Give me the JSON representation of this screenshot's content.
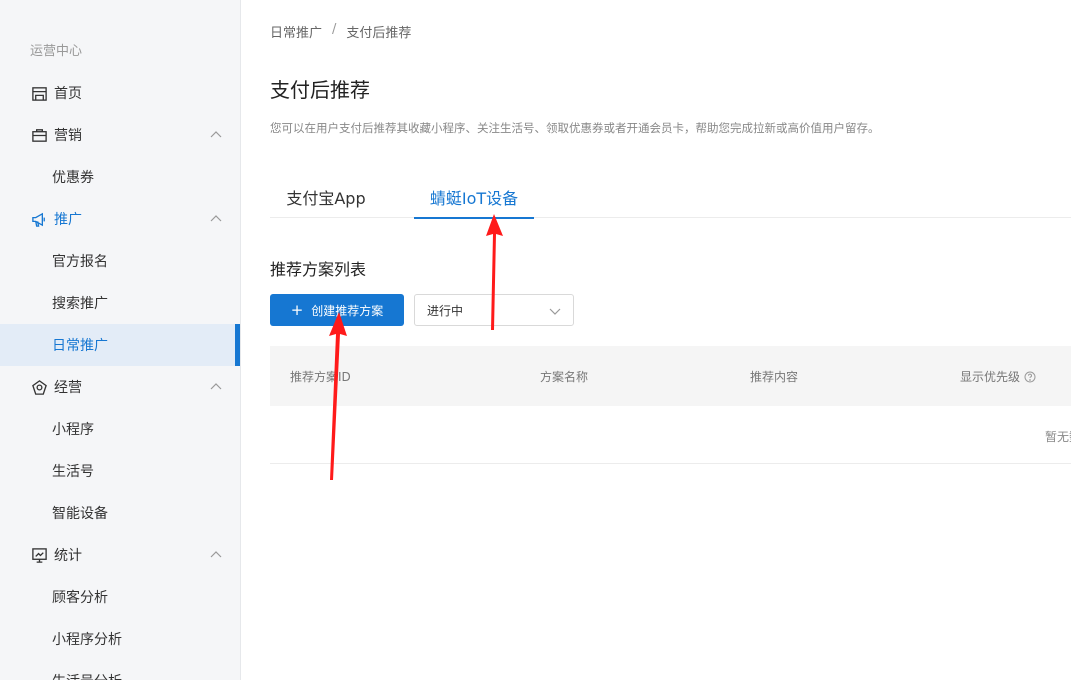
{
  "sidebar": {
    "section_title": "运营中心",
    "items": {
      "home": "首页",
      "marketing": "营销",
      "coupon": "优惠券",
      "promotion": "推广",
      "official_signup": "官方报名",
      "search_promo": "搜索推广",
      "daily_promo": "日常推广",
      "operation": "经营",
      "mini_program": "小程序",
      "life_account": "生活号",
      "smart_device": "智能设备",
      "stats": "统计",
      "customer_analysis": "顾客分析",
      "mini_program_analysis": "小程序分析",
      "life_account_analysis": "生活号分析"
    }
  },
  "breadcrumb": {
    "parent": "日常推广",
    "separator": "/",
    "current": "支付后推荐"
  },
  "page": {
    "title": "支付后推荐",
    "description": "您可以在用户支付后推荐其收藏小程序、关注生活号、领取优惠券或者开通会员卡，帮助您完成拉新或高价值用户留存。"
  },
  "tabs": [
    {
      "label": "支付宝App",
      "active": false
    },
    {
      "label": "蜻蜓IoT设备",
      "active": true
    }
  ],
  "section": {
    "title": "推荐方案列表",
    "create_button": "创建推荐方案",
    "status_select": "进行中"
  },
  "table": {
    "columns": [
      "推荐方案ID",
      "方案名称",
      "推荐内容",
      "显示优先级"
    ],
    "empty_text": "暂无数据"
  },
  "colors": {
    "accent": "#1677d2",
    "annotation_arrow": "#ff0000"
  },
  "icons": {
    "home": "shop-icon",
    "marketing": "briefcase-icon",
    "promotion": "megaphone-icon",
    "operation": "gem-icon",
    "stats": "monitor-chart-icon",
    "help": "question-circle-icon"
  }
}
